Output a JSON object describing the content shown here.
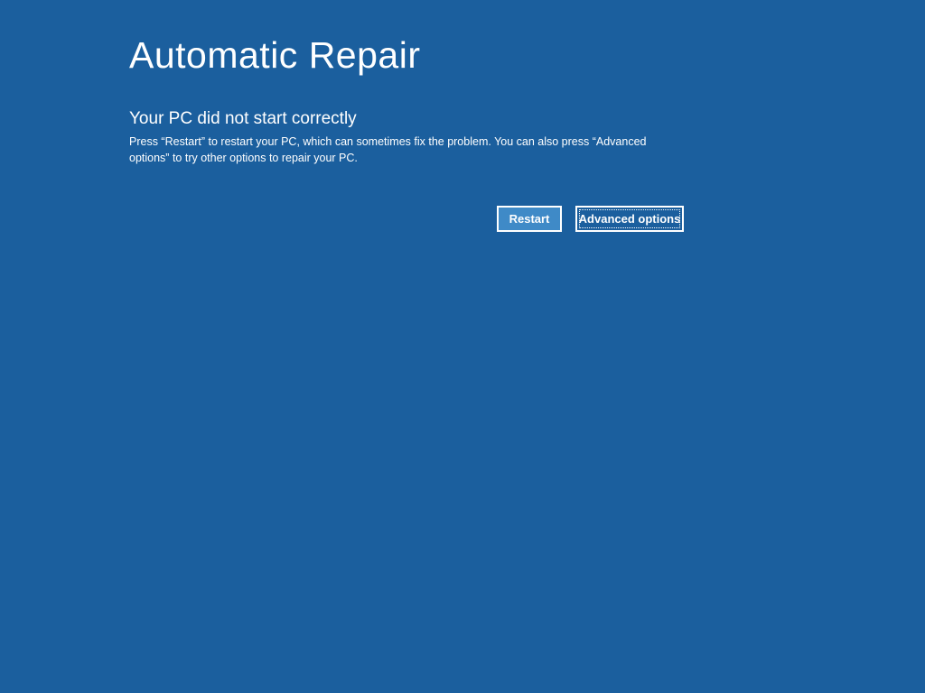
{
  "header": {
    "title": "Automatic Repair"
  },
  "main": {
    "subtitle": "Your PC did not start correctly",
    "description": "Press “Restart” to restart your PC, which can sometimes fix the problem. You can also press “Advanced options” to try other options to repair your PC."
  },
  "buttons": {
    "restart": "Restart",
    "advanced": "Advanced options"
  }
}
